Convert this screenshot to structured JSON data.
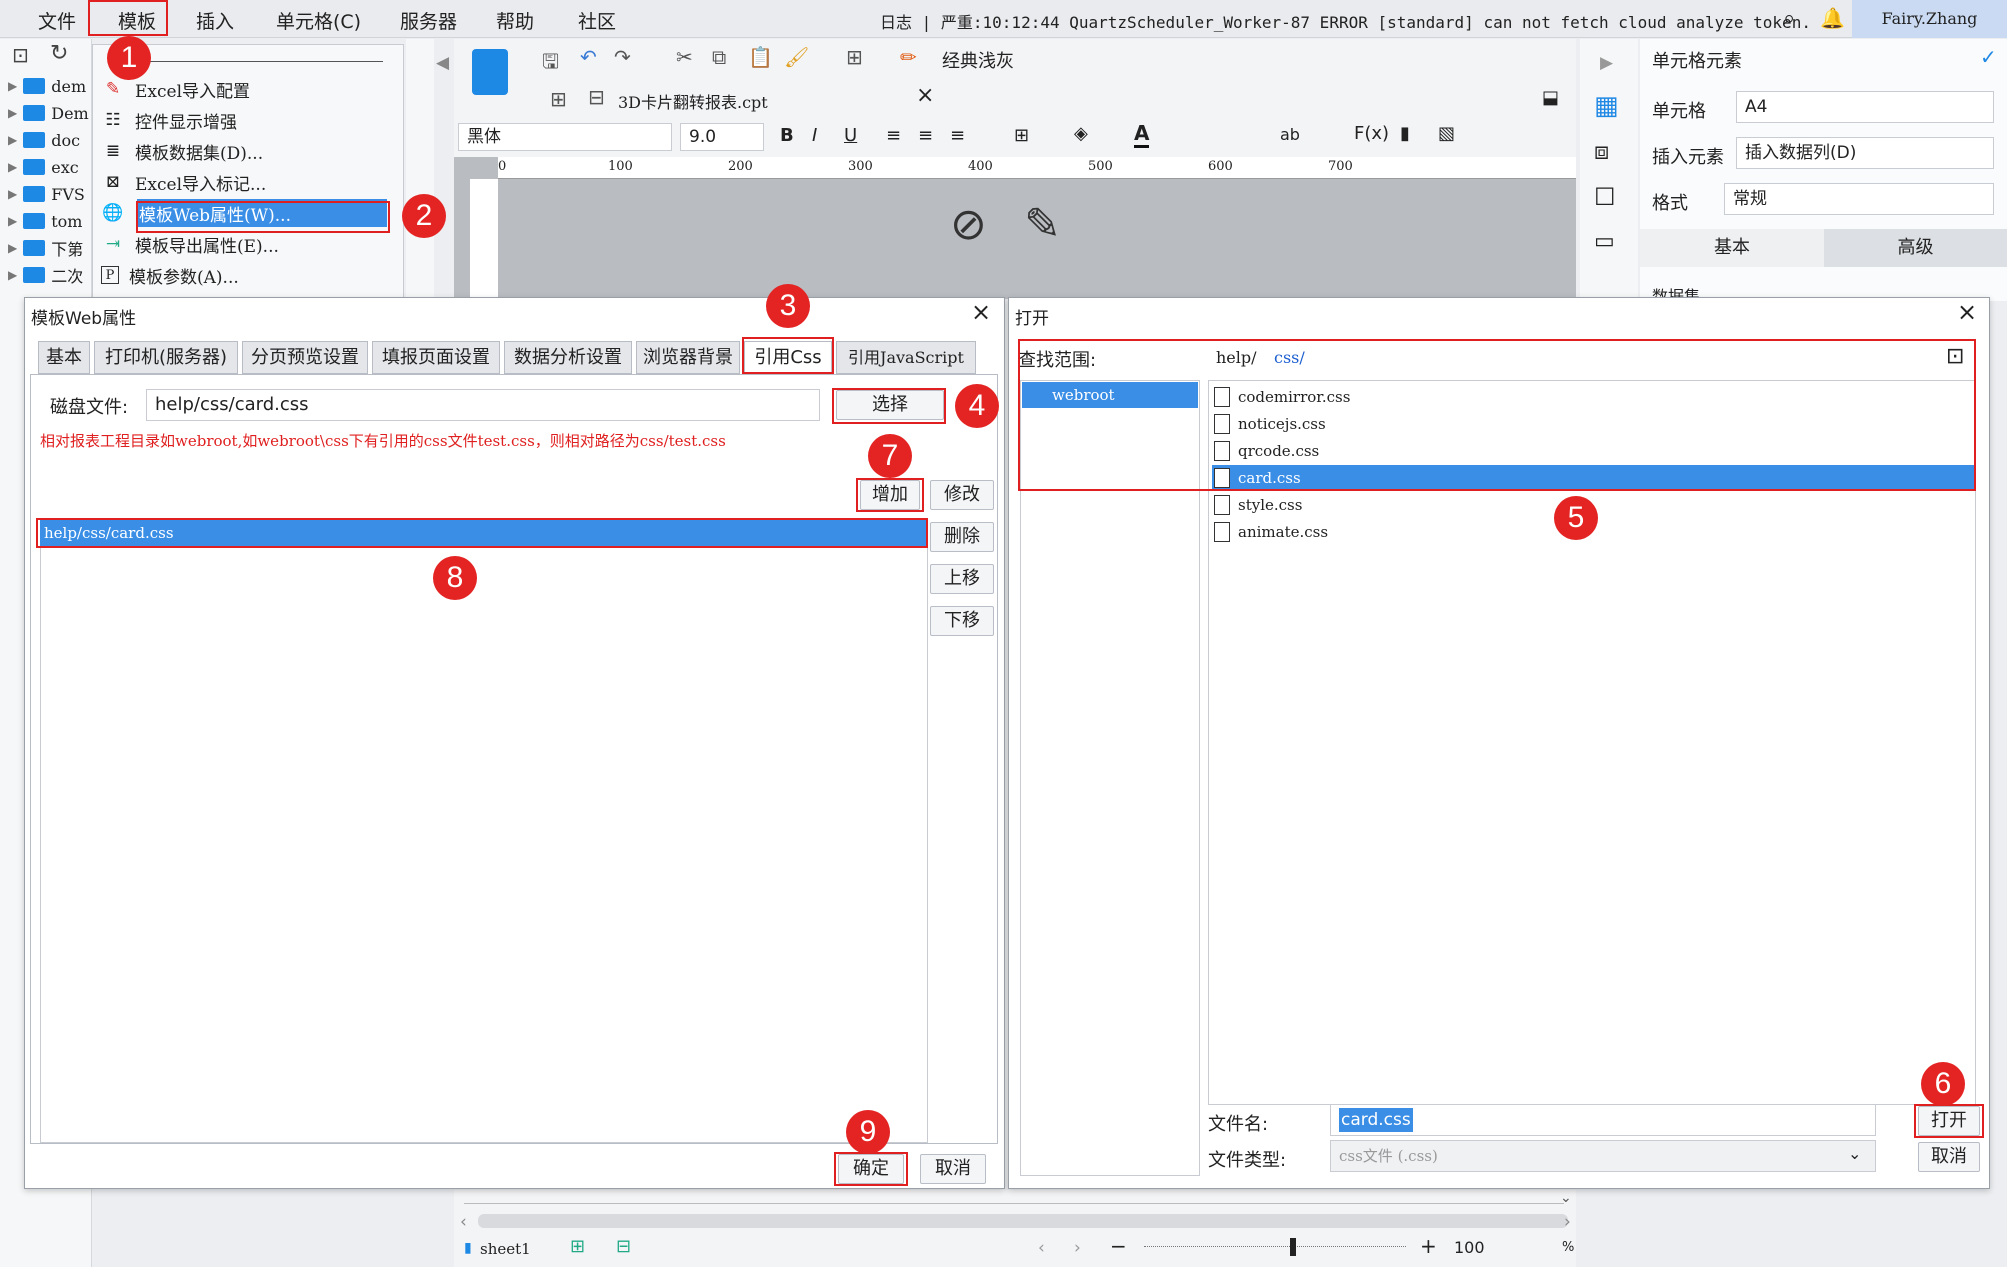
{
  "menubar": {
    "items": [
      "文件",
      "模板",
      "插入",
      "单元格(C)",
      "服务器",
      "帮助",
      "社区"
    ],
    "log": "日志 | 严重:10:12:44 QuartzScheduler_Worker-87 ERROR [standard] can not fetch cloud analyze token.",
    "user": "Fairy.Zhang"
  },
  "tree": {
    "items": [
      "dem",
      "Dem",
      "doc",
      "exc",
      "FVS",
      "tom",
      "下第",
      "二次"
    ]
  },
  "template_menu": {
    "items": [
      "Excel导入配置",
      "控件显示增强",
      "模板数据集(D)...",
      "Excel导入标记...",
      "模板Web属性(W)...",
      "模板导出属性(E)...",
      "模板参数(A)..."
    ]
  },
  "editor": {
    "tab_title": "3D卡片翻转报表.cpt",
    "style_label": "经典浅灰",
    "font": "黑体",
    "font_size": "9.0",
    "ruler": [
      "0",
      "100",
      "200",
      "300",
      "400",
      "500",
      "600",
      "700"
    ],
    "sheet": "sheet1",
    "zoom": "100",
    "zoom_unit": "%"
  },
  "right_panel": {
    "title": "单元格元素",
    "cell_label": "单元格",
    "cell_value": "A4",
    "insert_label": "插入元素",
    "insert_value": "插入数据列(D)",
    "format_label": "格式",
    "format_value": "常规",
    "tab_basic": "基本",
    "tab_advanced": "高级",
    "dataset_label": "数据集"
  },
  "web_dialog": {
    "title": "模板Web属性",
    "tabs": [
      "基本",
      "打印机(服务器)",
      "分页预览设置",
      "填报页面设置",
      "数据分析设置",
      "浏览器背景",
      "引用Css",
      "引用JavaScript"
    ],
    "disk_label": "磁盘文件:",
    "disk_value": "help/css/card.css",
    "choose": "选择",
    "hint": "相对报表工程目录如webroot,如webroot\\css下有引用的css文件test.css，则相对路径为css/test.css",
    "add": "增加",
    "modify": "修改",
    "delete": "删除",
    "up": "上移",
    "down": "下移",
    "list": [
      "help/css/card.css"
    ],
    "ok": "确定",
    "cancel": "取消"
  },
  "open_dialog": {
    "title": "打开",
    "lookin_label": "查找范围:",
    "path_root": "help/",
    "path_sub": "css/",
    "places": [
      "webroot"
    ],
    "files": [
      "codemirror.css",
      "noticejs.css",
      "qrcode.css",
      "card.css",
      "style.css",
      "animate.css"
    ],
    "filename_label": "文件名:",
    "filename_value": "card.css",
    "filetype_label": "文件类型:",
    "filetype_value": "css文件 (.css)",
    "open": "打开",
    "cancel": "取消"
  },
  "badges": [
    "1",
    "2",
    "3",
    "4",
    "5",
    "6",
    "7",
    "8",
    "9"
  ]
}
